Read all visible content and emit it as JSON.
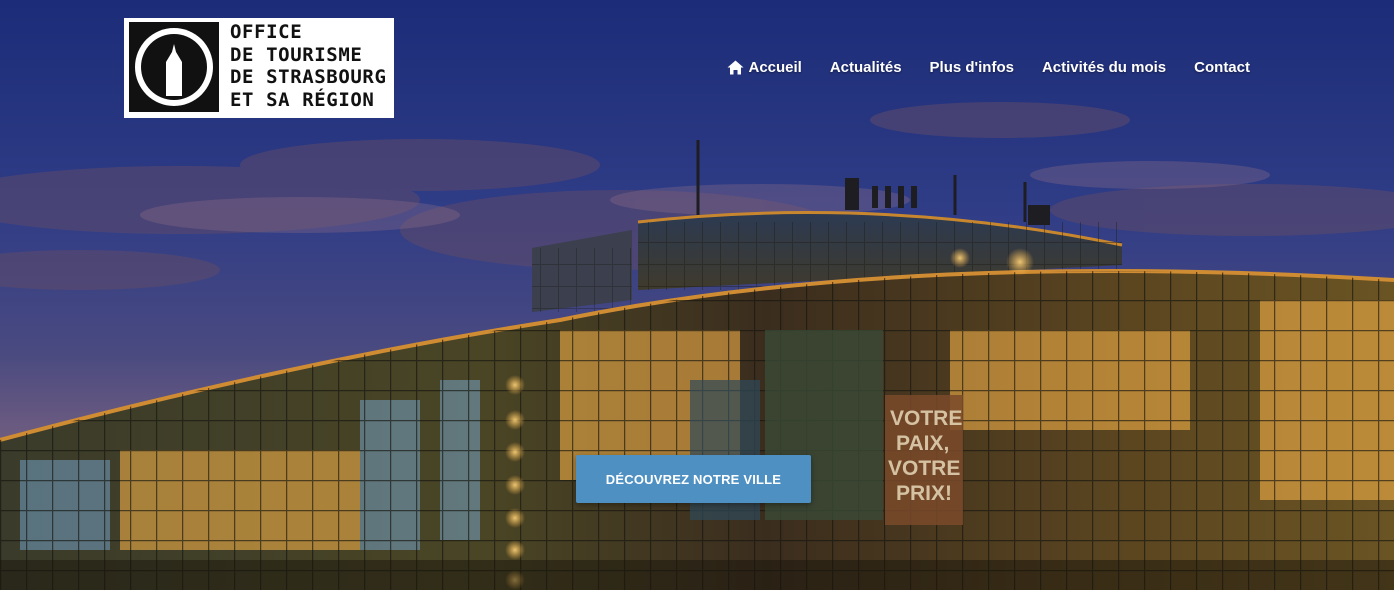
{
  "logo": {
    "lines": [
      "OFFICE",
      "DE TOURISME",
      "DE STRASBOURG",
      "ET SA RÉGION"
    ]
  },
  "nav": {
    "items": [
      {
        "label": "Accueil",
        "icon": "home-icon"
      },
      {
        "label": "Actualités"
      },
      {
        "label": "Plus d'infos"
      },
      {
        "label": "Activités du mois"
      },
      {
        "label": "Contact"
      }
    ]
  },
  "hero": {
    "banner_lines": [
      "VOTRE",
      "PAIX,",
      "VOTRE",
      "PRIX!"
    ],
    "cta_label": "DÉCOUVREZ NOTRE VILLE"
  },
  "colors": {
    "sky_top": "#1c2e7a",
    "sky_mid": "#3a3f78",
    "horizon": "#7a5a78",
    "cta": "#4f90c3",
    "lights": "#ffb84a"
  }
}
